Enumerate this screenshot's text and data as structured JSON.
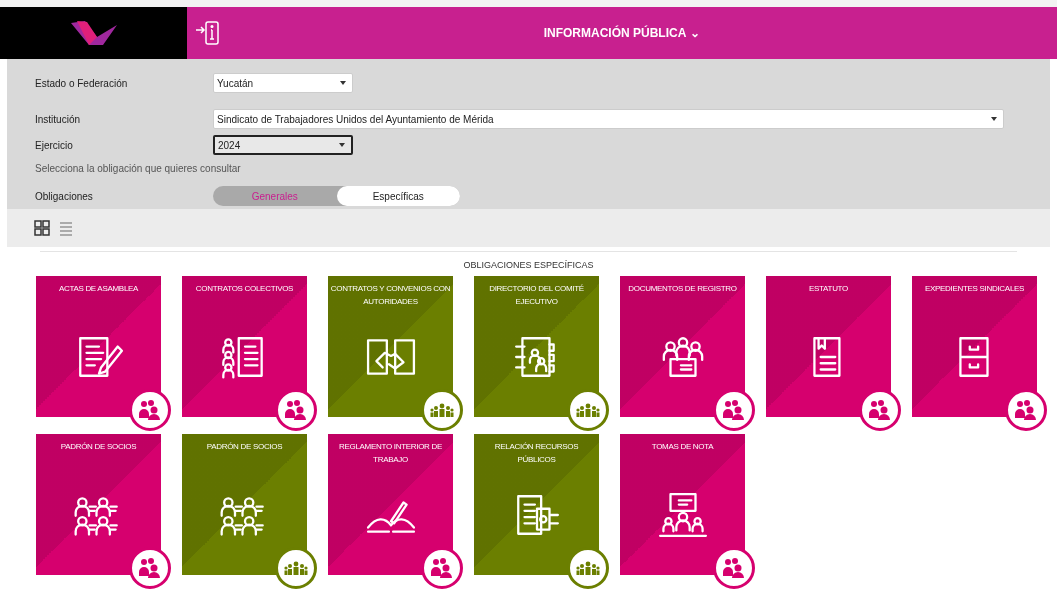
{
  "header": {
    "title": "INFORMACIÓN PÚBLICA",
    "caret": "⌄"
  },
  "filters": [
    {
      "label": "Estado o Federación",
      "value": "Yucatán",
      "kind": "short",
      "focused": false
    },
    {
      "label": "Institución",
      "value": "Sindicato de Trabajadores Unidos del Ayuntamiento de Mérida",
      "kind": "wide",
      "focused": false
    },
    {
      "label": "Ejercicio",
      "value": "2024",
      "kind": "short",
      "focused": true
    }
  ],
  "hint": "Selecciona la obligación que quieres consultar",
  "obligaciones": {
    "label": "Obligaciones",
    "options": [
      {
        "label": "Generales",
        "selected": false
      },
      {
        "label": "Específicas",
        "selected": true
      }
    ]
  },
  "views": [
    {
      "kind": "grid",
      "selected": true
    },
    {
      "kind": "list",
      "selected": false
    }
  ],
  "section_title": "OBLIGACIONES ESPECÍFICAS",
  "cards": [
    {
      "title": "ACTAS DE ASAMBLEA",
      "kind": "sindical",
      "color": "#d6006e"
    },
    {
      "title": "CONTRATOS COLECTIVOS",
      "kind": "sindical",
      "color": "#d6006e"
    },
    {
      "title": "CONTRATOS Y CONVENIOS CON AUTORIDADES",
      "kind": "comun",
      "color": "#6b7f00"
    },
    {
      "title": "DIRECTORIO DEL COMITÉ EJECUTIVO",
      "kind": "comun",
      "color": "#6b7f00"
    },
    {
      "title": "DOCUMENTOS DE REGISTRO",
      "kind": "sindical",
      "color": "#d6006e"
    },
    {
      "title": "ESTATUTO",
      "kind": "sindical",
      "color": "#d6006e"
    },
    {
      "title": "EXPEDIENTES SINDICALES",
      "kind": "sindical",
      "color": "#d6006e"
    },
    {
      "title": "PADRÓN DE SOCIOS",
      "kind": "sindical",
      "color": "#d6006e"
    },
    {
      "title": "PADRÓN DE SOCIOS",
      "kind": "comun",
      "color": "#6b7f00"
    },
    {
      "title": "REGLAMENTO INTERIOR DE TRABAJO",
      "kind": "sindical",
      "color": "#d6006e"
    },
    {
      "title": "RELACIÓN RECURSOS PÚBLICOS",
      "kind": "comun",
      "color": "#6b7f00"
    },
    {
      "title": "TOMAS DE NOTA",
      "kind": "sindical",
      "color": "#d6006e"
    }
  ]
}
